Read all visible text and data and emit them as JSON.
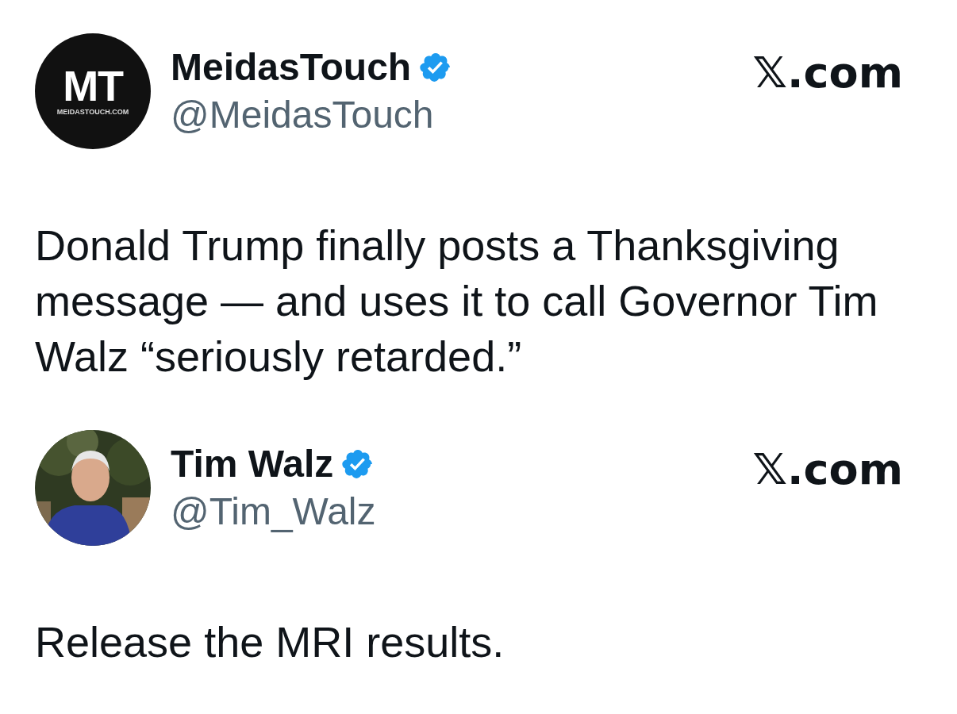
{
  "posts": [
    {
      "author": {
        "name": "MeidasTouch",
        "handle": "@MeidasTouch",
        "verified": true,
        "avatar": {
          "kind": "logo",
          "initials": "MT",
          "caption": "MEIDASTOUCH.COM"
        }
      },
      "source": "𝕏.com",
      "text": "Donald Trump finally posts a Thanksgiving message — and uses it to call Governor Tim Walz “seriously retarded.”"
    },
    {
      "author": {
        "name": "Tim Walz",
        "handle": "@Tim_Walz",
        "verified": true
      },
      "source": "𝕏.com",
      "text": "Release the MRI results."
    }
  ]
}
